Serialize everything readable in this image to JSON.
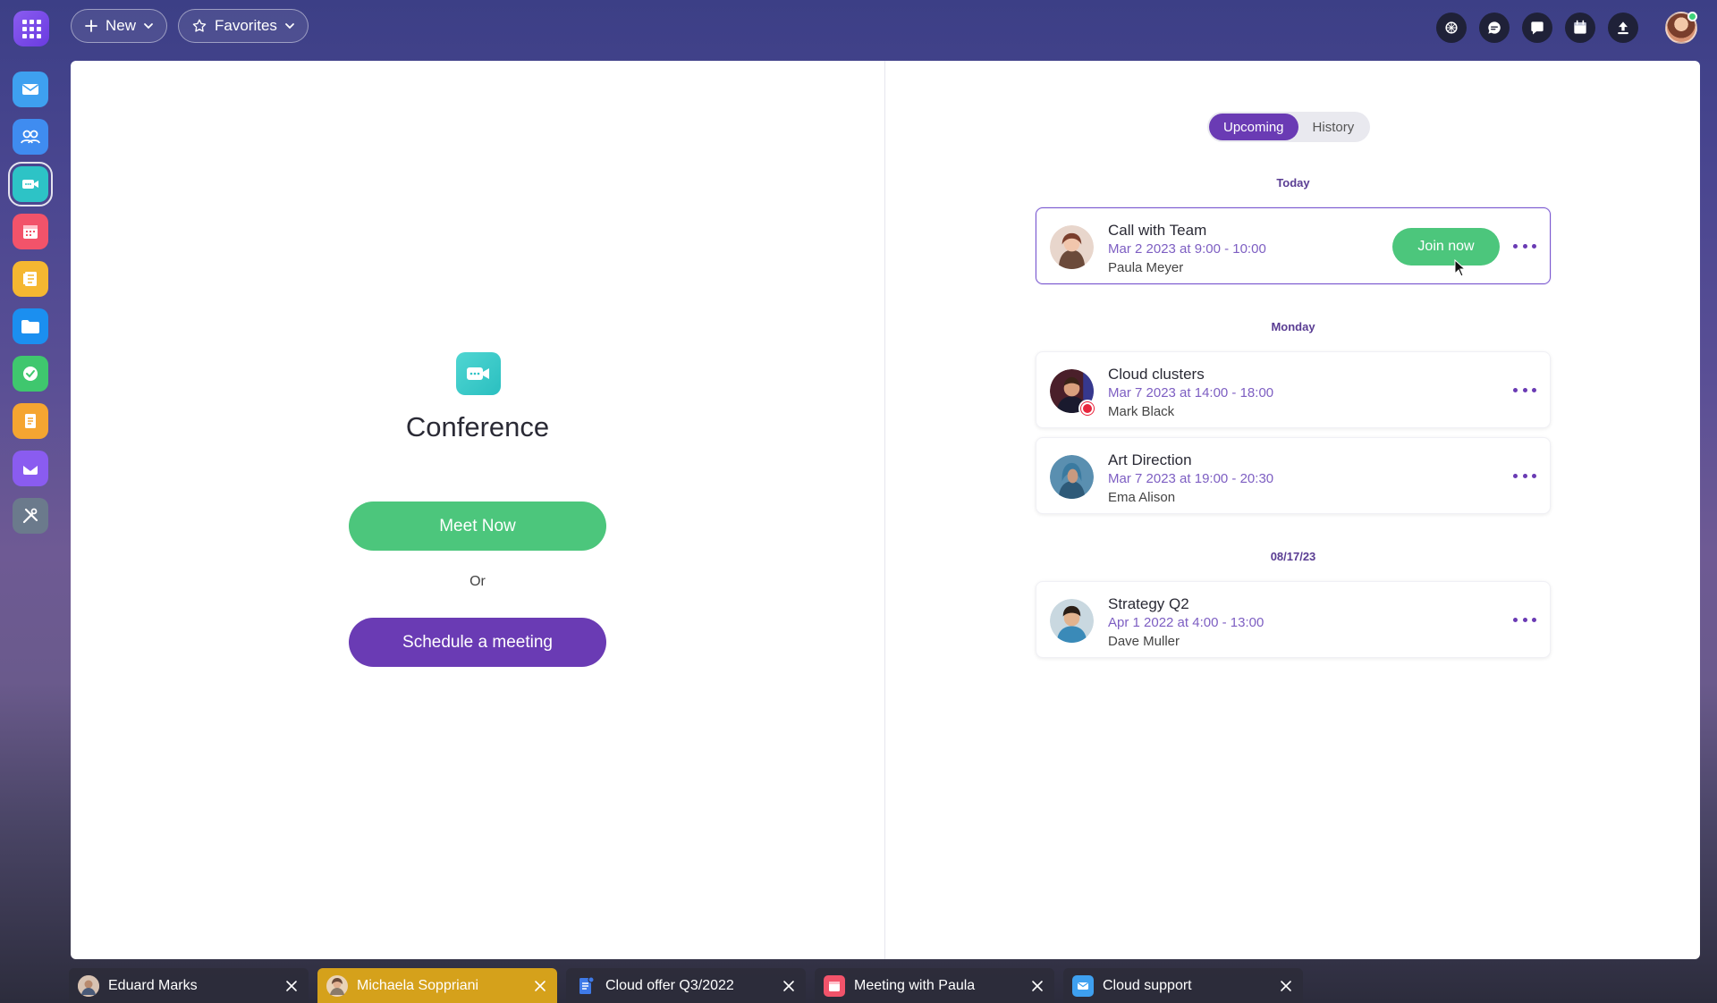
{
  "topbar": {
    "new_label": "New",
    "favorites_label": "Favorites",
    "icons": [
      "ai-assistant-icon",
      "chat-bubble-icon",
      "message-icon",
      "calendar-icon",
      "upload-icon"
    ]
  },
  "dock": {
    "apps": [
      {
        "name": "mail",
        "color": "#3ea0f0"
      },
      {
        "name": "contacts",
        "color": "#3f8cf0"
      },
      {
        "name": "conference",
        "color": "#2dc3c6"
      },
      {
        "name": "calendar",
        "color": "#f2536a"
      },
      {
        "name": "notes",
        "color": "#f5b731"
      },
      {
        "name": "files",
        "color": "#1b8ff0"
      },
      {
        "name": "tasks",
        "color": "#3fc76e"
      },
      {
        "name": "documents",
        "color": "#f5a531"
      },
      {
        "name": "inbox",
        "color": "#8a5cf0"
      },
      {
        "name": "tools",
        "color": "#6b7a8c"
      }
    ]
  },
  "conference": {
    "title": "Conference",
    "meet_now": "Meet Now",
    "or": "Or",
    "schedule": "Schedule a meeting"
  },
  "tabs": {
    "upcoming": "Upcoming",
    "history": "History"
  },
  "groups": {
    "today": "Today",
    "monday": "Monday",
    "date": "08/17/23"
  },
  "meetings": [
    {
      "title": "Call with Team",
      "time": "Mar 2 2023 at 9:00 - 10:00",
      "person": "Paula Meyer",
      "join": "Join now"
    },
    {
      "title": "Cloud clusters",
      "time": "Mar 7 2023 at 14:00 - 18:00",
      "person": "Mark Black"
    },
    {
      "title": "Art Direction",
      "time": "Mar 7 2023 at 19:00 - 20:30",
      "person": "Ema Alison"
    },
    {
      "title": "Strategy Q2",
      "time": "Apr 1 2022 at 4:00 - 13:00",
      "person": "Dave Muller"
    }
  ],
  "taskbar": [
    {
      "label": "Eduard Marks",
      "icon": "avatar-icon"
    },
    {
      "label": "Michaela Soppriani",
      "icon": "avatar-icon",
      "active": true
    },
    {
      "label": "Cloud offer Q3/2022",
      "icon": "document-icon"
    },
    {
      "label": "Meeting with Paula",
      "icon": "calendar-icon"
    },
    {
      "label": "Cloud support",
      "icon": "mail-icon"
    }
  ],
  "colors": {
    "accent": "#6a3bb4",
    "green": "#4cc67c",
    "active_task": "#d5a11b"
  }
}
